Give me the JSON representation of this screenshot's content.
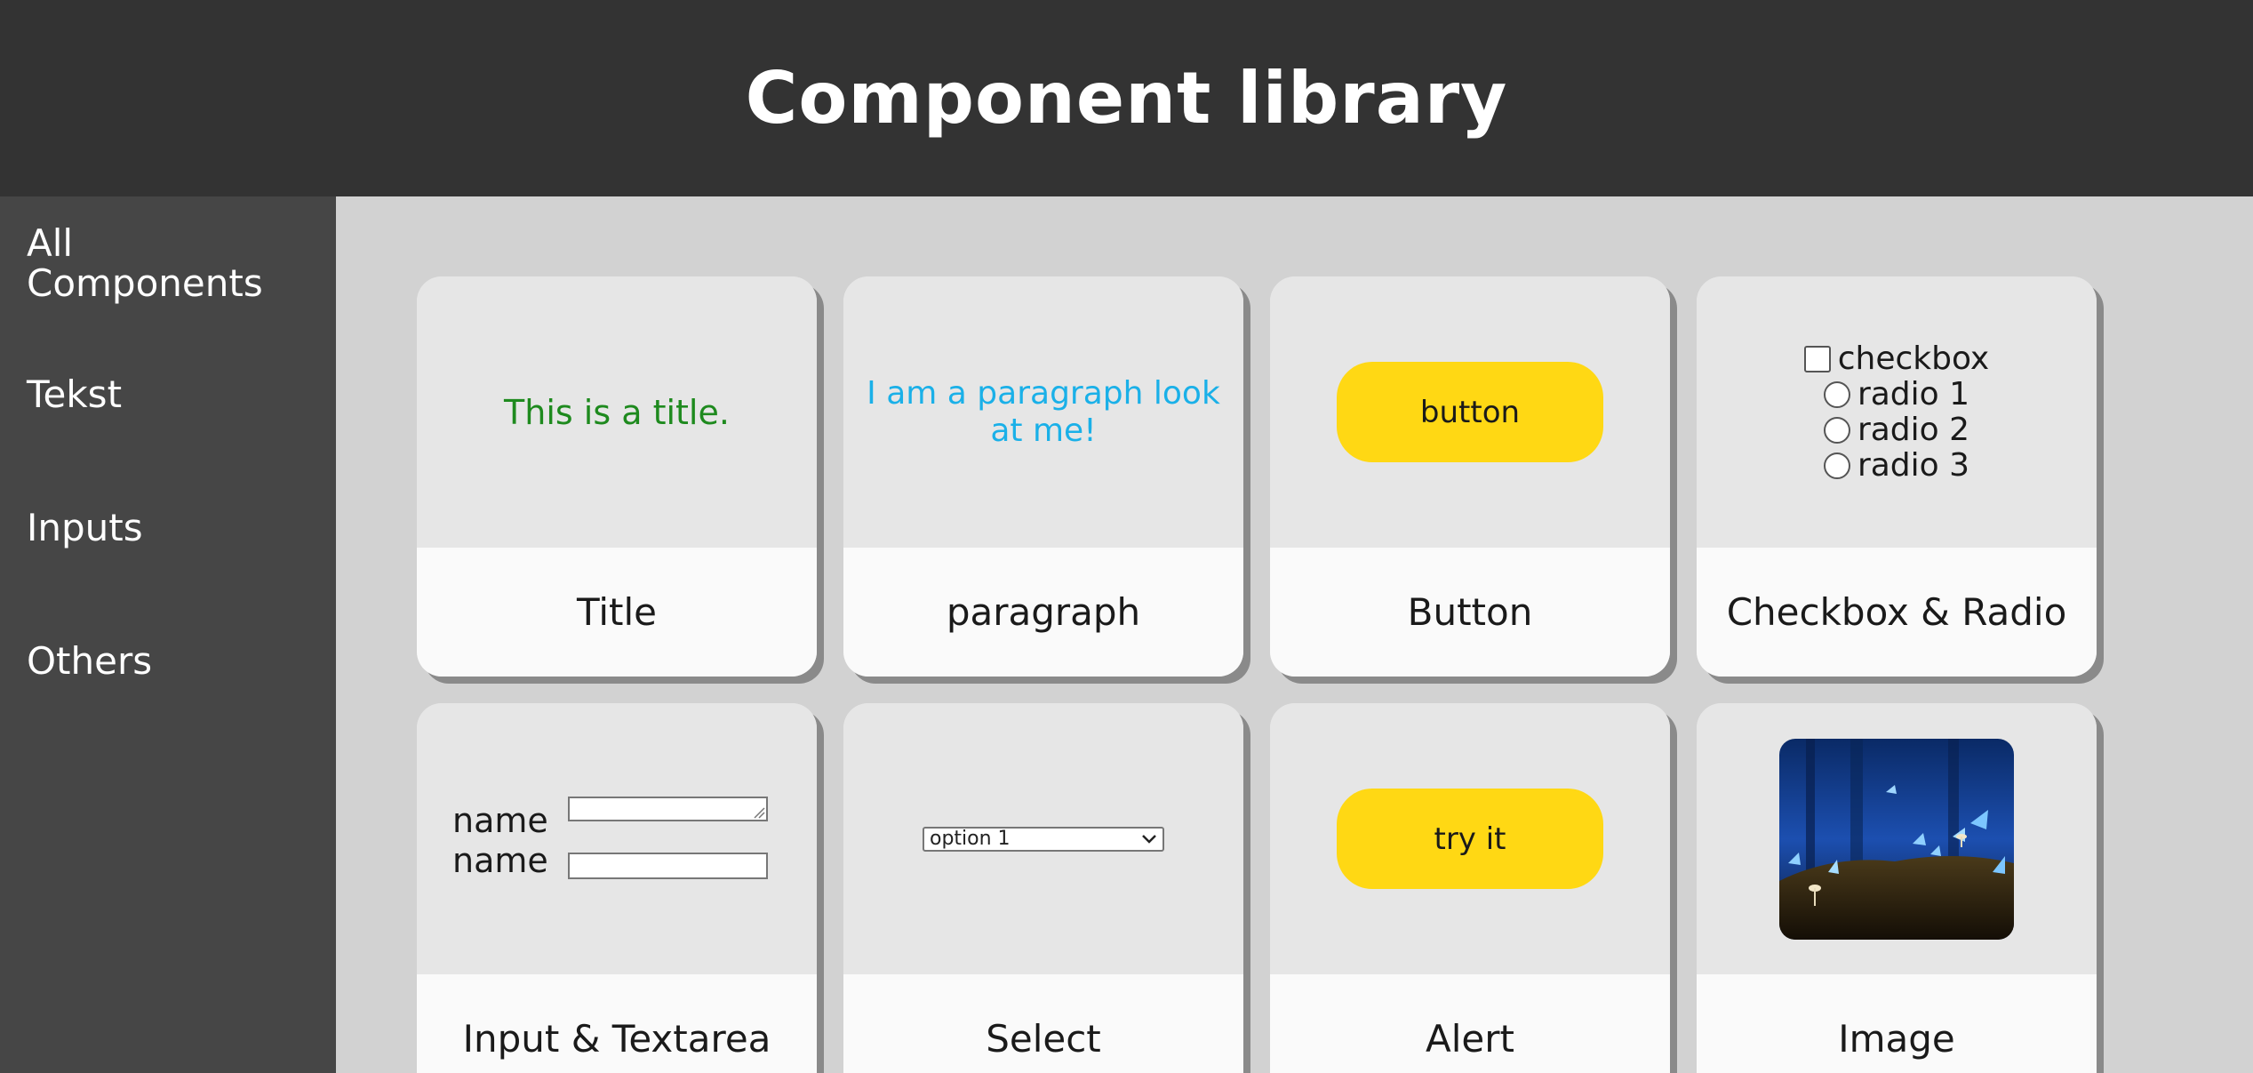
{
  "header": {
    "title": "Component library"
  },
  "sidebar": {
    "items": [
      {
        "label": "All Components"
      },
      {
        "label": "Tekst"
      },
      {
        "label": "Inputs"
      },
      {
        "label": "Others"
      }
    ]
  },
  "cards": {
    "title": {
      "caption": "Title",
      "demo_text": "This is a title."
    },
    "paragraph": {
      "caption": "paragraph",
      "demo_text": "I am a paragraph look at me!"
    },
    "button": {
      "caption": "Button",
      "button_label": "button"
    },
    "checkbox_radio": {
      "caption": "Checkbox & Radio",
      "checkbox_label": "checkbox",
      "radio_labels": [
        "radio 1",
        "radio 2",
        "radio 3"
      ]
    },
    "input_textarea": {
      "caption": "Input & Textarea",
      "textarea_label": "name",
      "input_label": "name"
    },
    "select": {
      "caption": "Select",
      "selected_option": "option 1"
    },
    "alert": {
      "caption": "Alert",
      "button_label": "try it"
    },
    "image": {
      "caption": "Image"
    }
  },
  "colors": {
    "header_bg": "#333333",
    "sidebar_bg": "#464646",
    "main_bg": "#d2d2d2",
    "button_yellow": "#ffd814",
    "title_green": "#1e8a1e",
    "paragraph_blue": "#1ab0e8"
  }
}
